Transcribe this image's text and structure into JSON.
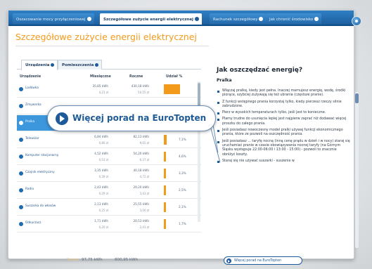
{
  "tabs": [
    "Oszacowanie mocy przyłączeniowej",
    "Szczegółowe zużycie energii elektrycznej",
    "Rachunek szczegółowy",
    "Jak chronić środowisko"
  ],
  "page_title": "Szczegółowe zużycie energii elektrycznej",
  "subtabs": [
    "Urządzenia",
    "Pomieszczenia"
  ],
  "table": {
    "headers": [
      "Urządzenie",
      "Miesięczne",
      "Roczne",
      "Udział %"
    ],
    "rows": [
      {
        "name": "Lodówka",
        "monthly": "35,85 kWh",
        "monthly_sub": "4,21 zł",
        "yearly": "430,18 kWh",
        "yearly_sub": "50,55 zł",
        "share": "",
        "share_value": 45
      },
      {
        "name": "Zmywarka",
        "monthly": "",
        "monthly_sub": "",
        "yearly": "",
        "yearly_sub": "",
        "share": "",
        "share_value": 0
      },
      {
        "name": "Pralka",
        "monthly": "",
        "monthly_sub": "",
        "yearly": "",
        "yearly_sub": "",
        "share": "",
        "share_value": 0
      },
      {
        "name": "Telewizor",
        "monthly": "6,84 kWh",
        "monthly_sub": "0,80 zł",
        "yearly": "82,13 kWh",
        "yearly_sub": "9,65 zł",
        "share": "7,1%",
        "share_value": 7.1
      },
      {
        "name": "Komputer stacjonarny",
        "monthly": "4,52 kWh",
        "monthly_sub": "0,53 zł",
        "yearly": "54,20 kWh",
        "yearly_sub": "6,37 zł",
        "share": "4,6%",
        "share_value": 4.6
      },
      {
        "name": "Czajnik elektryczny",
        "monthly": "3,35 kWh",
        "monthly_sub": "0,39 zł",
        "yearly": "40,18 kWh",
        "yearly_sub": "4,72 zł",
        "share": "3,3%",
        "share_value": 3.3
      },
      {
        "name": "Radio",
        "monthly": "2,43 kWh",
        "monthly_sub": "0,29 zł",
        "yearly": "29,20 kWh",
        "yearly_sub": "3,43 zł",
        "share": "2,5%",
        "share_value": 2.5
      },
      {
        "name": "Suszarka do włosów",
        "monthly": "2,13 kWh",
        "monthly_sub": "0,25 zł",
        "yearly": "25,55 kWh",
        "yearly_sub": "3,00 zł",
        "share": "2,1%",
        "share_value": 2.1
      },
      {
        "name": "Odkurzacz",
        "monthly": "1,71 kWh",
        "monthly_sub": "0,20 zł",
        "yearly": "20,53 kWh",
        "yearly_sub": "2,41 zł",
        "share": "1,7%",
        "share_value": 1.7
      }
    ]
  },
  "summary": {
    "label": "Suma:",
    "monthly": "97,75 kWh",
    "yearly": "800,95 kWh"
  },
  "tips_panel": {
    "title": "Jak oszczędzać energię?",
    "subtitle": "Pralka",
    "tips": [
      "Włączaj pralkę, kiedy jest pełna. Inaczej marnujesz energię, wodę, środki piorące, szybciej zużywają się też ubrania (częstsze pranie).",
      "Z funkcji wstępnego prania korzystaj tylko, kiedy pierzesz rzeczy silnie zabrudzone.",
      "Pierz w wysokich temperaturach tylko, jeśli jest to konieczne.",
      "Plamy trudne do usunięcia lepiej jest najpierw zaprać niż dodawać więcej proszku do całego prania.",
      "Jeśli posiadasz nowoczesny model pralki używaj funkcji ekonomicznego prania, które ze pozwoli na oszczędność prania.",
      "Jeśli posiadasz ... taryfę nocną (inną cenę prądu w dzień i w nocy) staraj się uruchamiać pranie w czasie obowiązywania nocnej taryfy (na Górnym Śląsku występuje 22:00-06:00 i 13:00 - 15:00) - pozwoli to znacznie obniżyć koszty.",
      "Staraj się nie używać suszarki - suszenie w"
    ],
    "link_label": "Więcej porad na EuroTopten"
  },
  "callout_label": "Więcej porad na EuroTopten",
  "colors": {
    "accent_orange": "#f39a1a",
    "brand_blue": "#1e5a9a",
    "highlight_row": "#3c97dc"
  }
}
